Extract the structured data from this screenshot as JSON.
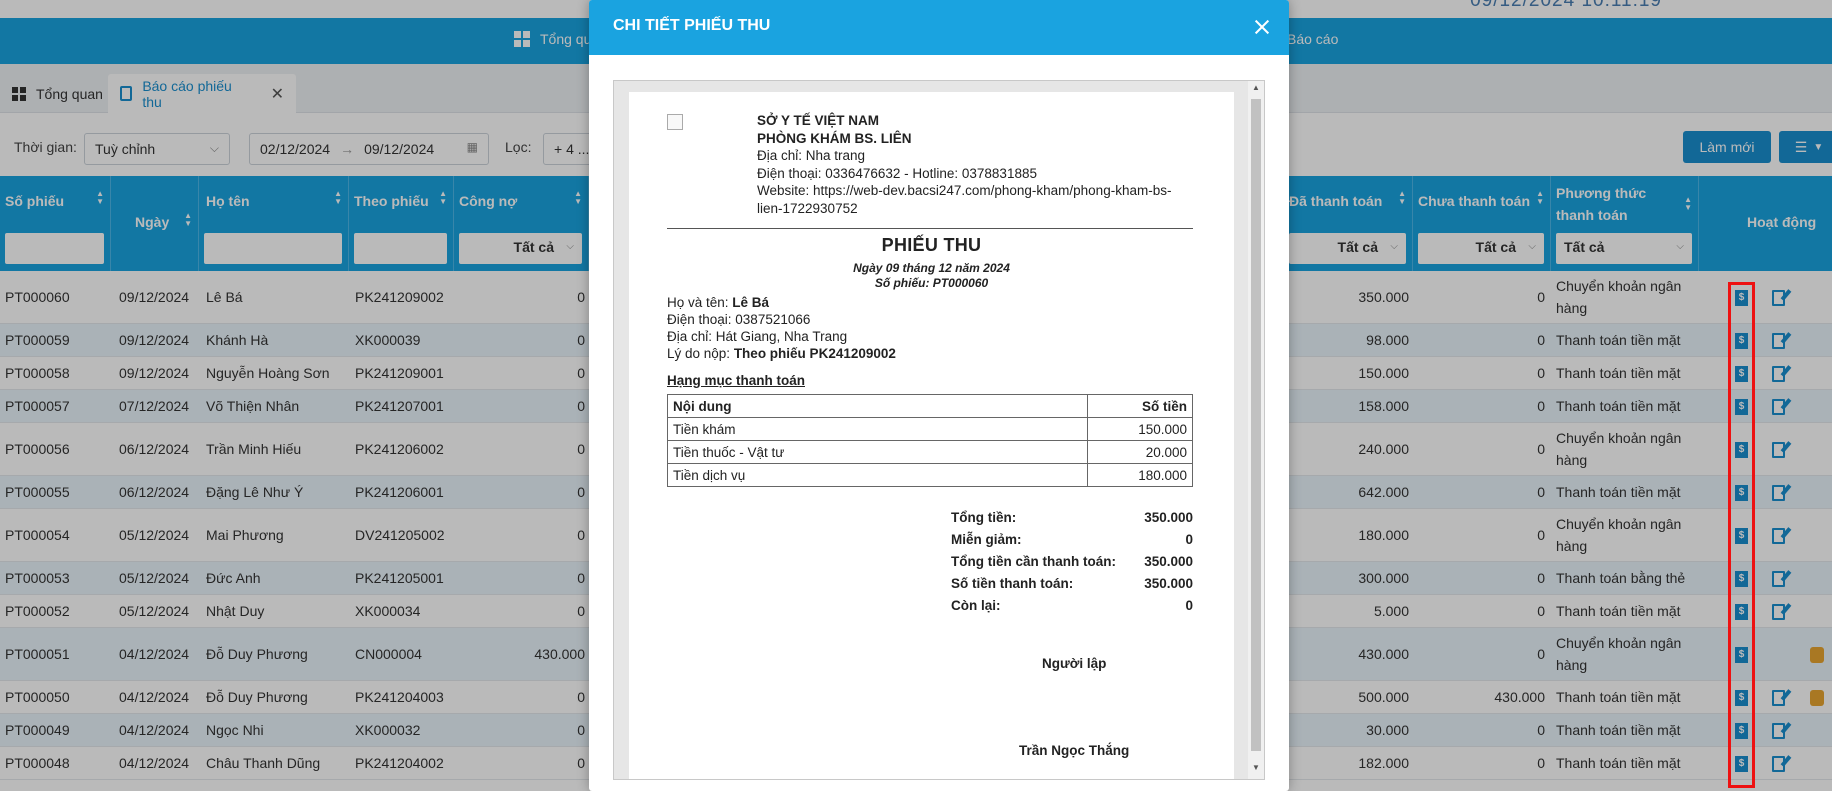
{
  "top": {
    "clock": "09/12/2024 10:11:19"
  },
  "nav": {
    "overview": "Tổng quan",
    "report": "Báo cáo"
  },
  "tabs": [
    {
      "label": "Tổng quan"
    },
    {
      "label": "Báo cáo phiếu thu"
    }
  ],
  "filters": {
    "time_label": "Thời gian:",
    "time_value": "Tuỳ chỉnh",
    "date_from": "02/12/2024",
    "date_arrow": "→",
    "date_to": "09/12/2024",
    "filter_label": "Lọc:",
    "filter_value": "+ 4 ..."
  },
  "toolbar": {
    "refresh": "Làm mới"
  },
  "columns": {
    "so_phieu": "Số phiếu",
    "ngay": "Ngày",
    "ho_ten": "Họ tên",
    "theo_phieu": "Theo phiếu",
    "cong_no": "Công nợ",
    "da_thanh_toan": "Đã thanh toán",
    "chua_thanh_toan": "Chưa thanh toán",
    "pttt": "Phương thức thanh toán",
    "hoat_dong": "Hoạt động",
    "all": "Tất cả"
  },
  "rows": [
    {
      "so": "PT000060",
      "ngay": "09/12/2024",
      "ten": "Lê Bá",
      "theo": "PK241209002",
      "cong_no": "0",
      "da_tt": "350.000",
      "chua_tt": "0",
      "pttt": "Chuyển khoản ngân hàng"
    },
    {
      "so": "PT000059",
      "ngay": "09/12/2024",
      "ten": "Khánh Hà",
      "theo": "XK000039",
      "cong_no": "0",
      "da_tt": "98.000",
      "chua_tt": "0",
      "pttt": "Thanh toán tiền mặt"
    },
    {
      "so": "PT000058",
      "ngay": "09/12/2024",
      "ten": "Nguyễn Hoàng Sơn",
      "theo": "PK241209001",
      "cong_no": "0",
      "da_tt": "150.000",
      "chua_tt": "0",
      "pttt": "Thanh toán tiền mặt"
    },
    {
      "so": "PT000057",
      "ngay": "07/12/2024",
      "ten": "Võ Thiện Nhân",
      "theo": "PK241207001",
      "cong_no": "0",
      "da_tt": "158.000",
      "chua_tt": "0",
      "pttt": "Thanh toán tiền mặt"
    },
    {
      "so": "PT000056",
      "ngay": "06/12/2024",
      "ten": "Trần Minh Hiếu",
      "theo": "PK241206002",
      "cong_no": "0",
      "da_tt": "240.000",
      "chua_tt": "0",
      "pttt": "Chuyển khoản ngân hàng"
    },
    {
      "so": "PT000055",
      "ngay": "06/12/2024",
      "ten": "Đặng Lê Như Ý",
      "theo": "PK241206001",
      "cong_no": "0",
      "da_tt": "642.000",
      "chua_tt": "0",
      "pttt": "Thanh toán tiền mặt"
    },
    {
      "so": "PT000054",
      "ngay": "05/12/2024",
      "ten": "Mai Phương",
      "theo": "DV241205002",
      "cong_no": "0",
      "da_tt": "180.000",
      "chua_tt": "0",
      "pttt": "Chuyển khoản ngân hàng"
    },
    {
      "so": "PT000053",
      "ngay": "05/12/2024",
      "ten": "Đức Anh",
      "theo": "PK241205001",
      "cong_no": "0",
      "da_tt": "300.000",
      "chua_tt": "0",
      "pttt": "Thanh toán bằng thẻ"
    },
    {
      "so": "PT000052",
      "ngay": "05/12/2024",
      "ten": "Nhật Duy",
      "theo": "XK000034",
      "cong_no": "0",
      "da_tt": "5.000",
      "chua_tt": "0",
      "pttt": "Thanh toán tiền mặt"
    },
    {
      "so": "PT000051",
      "ngay": "04/12/2024",
      "ten": "Đỗ Duy Phương",
      "theo": "CN000004",
      "cong_no": "430.000",
      "da_tt": "430.000",
      "chua_tt": "0",
      "pttt": "Chuyển khoản ngân hàng"
    },
    {
      "so": "PT000050",
      "ngay": "04/12/2024",
      "ten": "Đỗ Duy Phương",
      "theo": "PK241204003",
      "cong_no": "0",
      "da_tt": "500.000",
      "chua_tt": "430.000",
      "pttt": "Thanh toán tiền mặt"
    },
    {
      "so": "PT000049",
      "ngay": "04/12/2024",
      "ten": "Ngọc Nhi",
      "theo": "XK000032",
      "cong_no": "0",
      "da_tt": "30.000",
      "chua_tt": "0",
      "pttt": "Thanh toán tiền mặt"
    },
    {
      "so": "PT000048",
      "ngay": "04/12/2024",
      "ten": "Châu Thanh Dũng",
      "theo": "PK241204002",
      "cong_no": "0",
      "da_tt": "182.000",
      "chua_tt": "0",
      "pttt": "Thanh toán tiền mặt"
    }
  ],
  "modal": {
    "title": "CHI TIẾT PHIẾU THU",
    "receipt": {
      "org": "SỞ Y TẾ VIỆT NAM",
      "clinic": "PHÒNG KHÁM BS. LIÊN",
      "address": "Địa chỉ: Nha trang",
      "phone": "Điện thoại: 0336476632 - Hotline: 0378831885",
      "website_1": "Website: https://web-dev.bacsi247.com/phong-kham/phong-kham-bs-",
      "website_2": "lien-1722930752",
      "title": "PHIẾU THU",
      "date_line": "Ngày 09 tháng 12 năm 2024",
      "number_line": "Số phiếu: PT000060",
      "name_label": "Họ và tên: ",
      "name_value": "Lê Bá",
      "phone_line": "Điện thoại: 0387521066",
      "address_line": "Địa chỉ: Hát Giang, Nha Trang",
      "reason_label": "Lý do nộp: ",
      "reason_value": "Theo phiếu PK241209002",
      "section": "Hạng mục thanh toán",
      "table_head_content": "Nội dung",
      "table_head_amount": "Số tiền",
      "items": [
        {
          "name": "Tiền khám",
          "amount": "150.000"
        },
        {
          "name": "Tiền thuốc - Vật tư",
          "amount": "20.000"
        },
        {
          "name": "Tiền dịch vụ",
          "amount": "180.000"
        }
      ],
      "totals": [
        {
          "label": "Tổng tiền:",
          "value": "350.000"
        },
        {
          "label": "Miễn giảm:",
          "value": "0"
        },
        {
          "label": "Tổng tiền cần thanh toán:",
          "value": "350.000"
        },
        {
          "label": "Số tiền thanh toán:",
          "value": "350.000"
        },
        {
          "label": "Còn lại:",
          "value": "0"
        }
      ],
      "signer_title": "Người lập",
      "signer_name": "Trần Ngọc Thắng"
    }
  }
}
